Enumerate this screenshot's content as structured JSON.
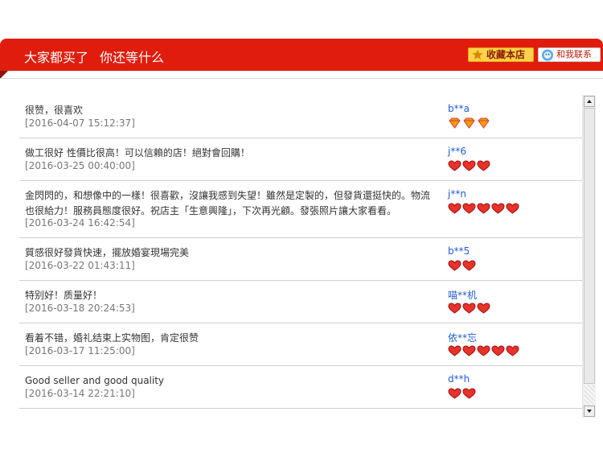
{
  "header": {
    "title_a": "大家都买了",
    "title_b": "你还等什么",
    "favorite_label": "收藏本店",
    "contact_label": "和我联系",
    "brand_red": "#e01d0c"
  },
  "reviews": [
    {
      "text": "很赞，很喜欢",
      "date": "[2016-04-07 15:12:37]",
      "user": "b**a",
      "rating_icon": "diamond-icon",
      "rating_count": 3
    },
    {
      "text": "做工很好 性價比很高！可以信賴的店！絕對會回購！",
      "date": "[2016-03-25 00:40:00]",
      "user": "j**6",
      "rating_icon": "heart-icon",
      "rating_count": 3
    },
    {
      "text": "金閃閃的，和想像中的一樣！很喜歡，沒讓我感到失望！雖然是定製的，但發貨還挺快的。物流也很給力！服務員態度很好。祝店主「生意興隆」，下次再光顧。發張照片讓大家看看。",
      "date": "[2016-03-24 16:42:54]",
      "user": "j**n",
      "rating_icon": "heart-icon",
      "rating_count": 5
    },
    {
      "text": "質感很好發貨快速，擺放婚宴現場完美",
      "date": "[2016-03-22 01:43:11]",
      "user": "b**5",
      "rating_icon": "heart-icon",
      "rating_count": 2
    },
    {
      "text": "特别好！质量好！",
      "date": "[2016-03-18 20:24:53]",
      "user": "喵**机",
      "rating_icon": "heart-icon",
      "rating_count": 3
    },
    {
      "text": "看着不错，婚礼结束上实物图，肯定很赞",
      "date": "[2016-03-17 11:25:00]",
      "user": "依**忘",
      "rating_icon": "heart-icon",
      "rating_count": 5
    },
    {
      "text": "Good seller and good quality",
      "date": "[2016-03-14 22:21:10]",
      "user": "d**h",
      "rating_icon": "heart-icon",
      "rating_count": 2
    }
  ]
}
